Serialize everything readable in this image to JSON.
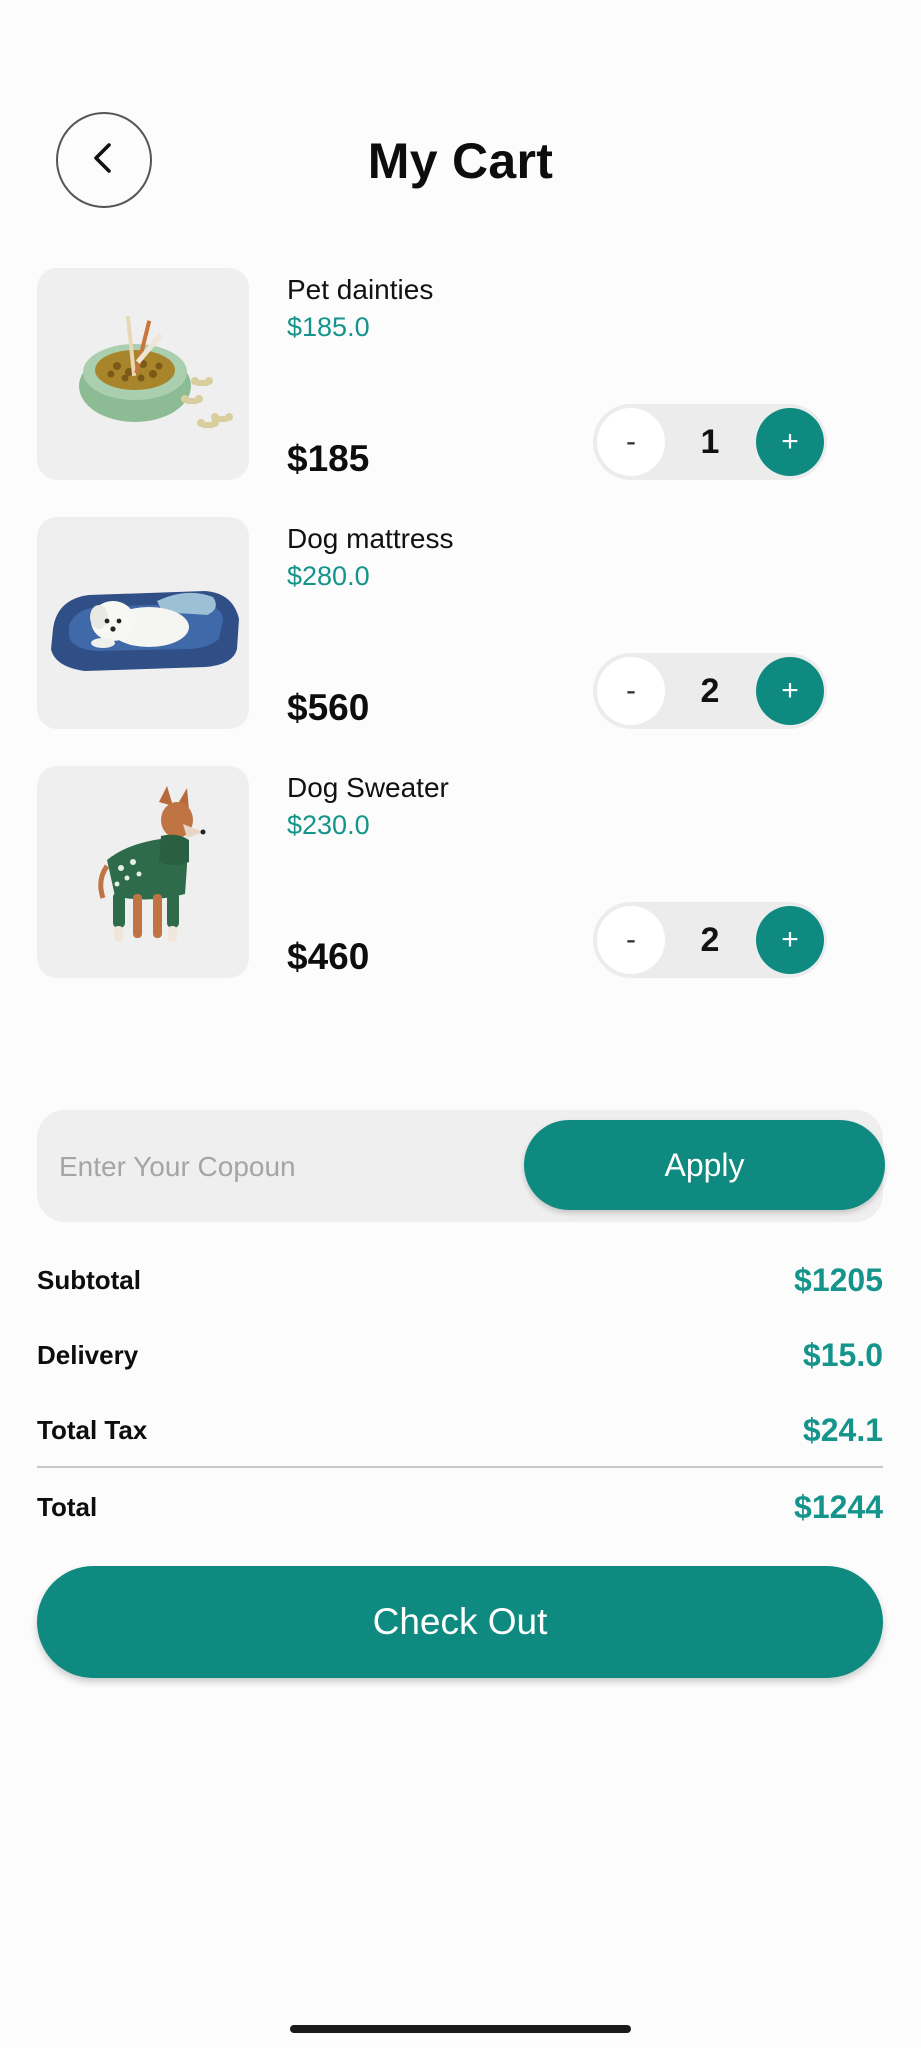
{
  "header": {
    "title": "My Cart",
    "back_icon": "chevron-left-icon"
  },
  "cart": {
    "items": [
      {
        "name": "Pet dainties",
        "unit_price": "$185.0",
        "total": "$185",
        "quantity": "1",
        "minus_label": "-",
        "plus_label": "+",
        "image": "food-bowl-with-treats"
      },
      {
        "name": "Dog mattress",
        "unit_price": "$280.0",
        "total": "$560",
        "quantity": "2",
        "minus_label": "-",
        "plus_label": "+",
        "image": "dog-on-blue-bed"
      },
      {
        "name": "Dog Sweater",
        "unit_price": "$230.0",
        "total": "$460",
        "quantity": "2",
        "minus_label": "-",
        "plus_label": "+",
        "image": "dog-in-green-sweater"
      }
    ]
  },
  "coupon": {
    "placeholder": "Enter Your Copoun",
    "value": "",
    "apply_label": "Apply"
  },
  "summary": {
    "subtotal_label": "Subtotal",
    "subtotal_value": "$1205",
    "delivery_label": "Delivery",
    "delivery_value": "$15.0",
    "tax_label": "Total Tax",
    "tax_value": "$24.1",
    "total_label": "Total",
    "total_value": "$1244"
  },
  "checkout": {
    "label": "Check Out"
  },
  "colors": {
    "accent": "#0e8a80",
    "accent_text": "#14948a",
    "background": "#fdfcfc",
    "card_background": "#f0efef"
  }
}
